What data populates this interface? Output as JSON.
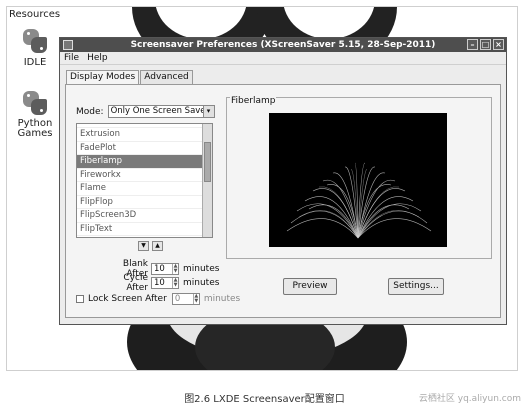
{
  "desktop": {
    "label": "Resources",
    "icons": [
      {
        "label": "IDLE"
      },
      {
        "label": "Python\nGames"
      }
    ]
  },
  "window": {
    "title": "Screensaver Preferences  (XScreenSaver 5.15, 28-Sep-2011)",
    "controls": [
      "–",
      "□",
      "×"
    ]
  },
  "menubar": {
    "file": "File",
    "help": "Help"
  },
  "tabs": {
    "display_modes": "Display Modes",
    "advanced": "Advanced"
  },
  "mode": {
    "label": "Mode:",
    "value": "Only One Screen Saver",
    "arrow": "▾"
  },
  "savers": [
    "Extrusion",
    "FadePlot",
    "Fiberlamp",
    "Fireworkx",
    "Flame",
    "FlipFlop",
    "FlipScreen3D",
    "FlipText"
  ],
  "selected_saver": "Fiberlamp",
  "nav": {
    "down": "▼",
    "up": "▲"
  },
  "blank_after": {
    "label": "Blank After",
    "value": "10",
    "unit": "minutes"
  },
  "cycle_after": {
    "label": "Cycle After",
    "value": "10",
    "unit": "minutes"
  },
  "lock_screen": {
    "label": "Lock Screen After",
    "value": "0",
    "unit": "minutes",
    "checked": false
  },
  "preview": {
    "legend": "Fiberlamp"
  },
  "buttons": {
    "preview": "Preview",
    "settings": "Settings..."
  },
  "caption": "图2.6   LXDE Screensaver配置窗口",
  "watermark": "云栖社区 yq.aliyun.com"
}
